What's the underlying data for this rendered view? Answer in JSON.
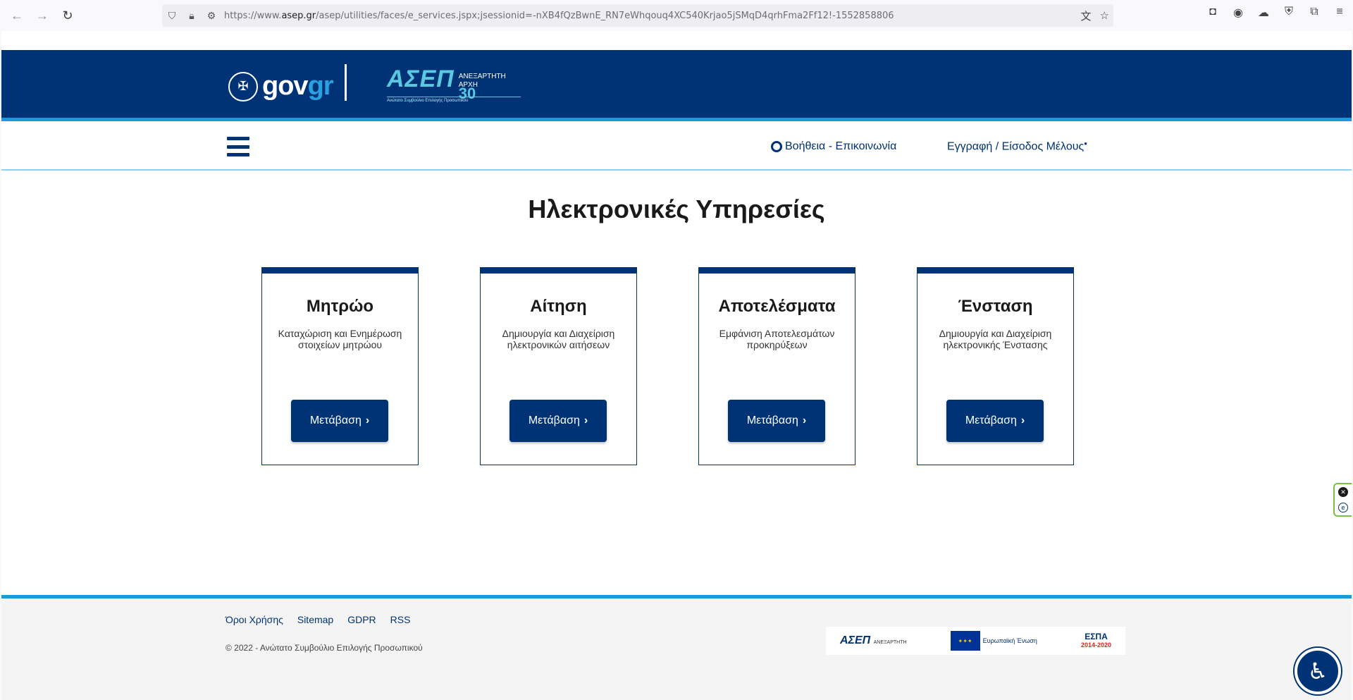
{
  "browser": {
    "url_prefix": "https://www.",
    "url_domain": "asep.gr",
    "url_rest": "/asep/utilities/faces/e_services.jspx;jsessionid=-nXB4fQzBwnE_RN7eWhqouq4XC540Krjao5jSMqD4qrhFma2Ff12!-1552858806"
  },
  "header": {
    "gov_brand_gov": "gov",
    "gov_brand_gr": "gr",
    "asep_mark": "ΑΣΕΠ",
    "asep_side_line1": "ΑΝΕΞΑΡΤΗΤΗ",
    "asep_side_line2": "ΑΡΧΗ",
    "asep_30": "30",
    "asep_sub": "Ανώτατο Συμβούλιο Επιλογής Προσωπικού"
  },
  "subnav": {
    "help_label": "Βοήθεια - Επικοινωνία",
    "login_label": "Εγγραφή / Είσοδος Μέλους"
  },
  "main": {
    "title": "Ηλεκτρονικές Υπηρεσίες",
    "cards": [
      {
        "title": "Μητρώο",
        "desc": "Καταχώριση και Ενημέρωση στοιχείων μητρώου",
        "button": "Μετάβαση"
      },
      {
        "title": "Αίτηση",
        "desc": "Δημιουργία και Διαχείριση ηλεκτρονικών αιτήσεων",
        "button": "Μετάβαση"
      },
      {
        "title": "Αποτελέσματα",
        "desc": "Εμφάνιση Αποτελεσμάτων προκηρύξεων",
        "button": "Μετάβαση"
      },
      {
        "title": "Ένσταση",
        "desc": "Δημιουργία και Διαχείριση ηλεκτρονικής Ένστασης",
        "button": "Μετάβαση"
      }
    ]
  },
  "footer": {
    "links": [
      "Όροι Χρήσης",
      "Sitemap",
      "GDPR",
      "RSS"
    ],
    "copyright": "© 2022 - Ανώτατο Συμβούλιο Επιλογής Προσωπικού",
    "eu_label": "Ευρωπαϊκή Ένωση",
    "espa_label": "ΕΣΠΑ",
    "espa_years": "2014-2020"
  },
  "colors": {
    "brand_navy": "#003375",
    "accent_blue": "#1a9ad6"
  }
}
